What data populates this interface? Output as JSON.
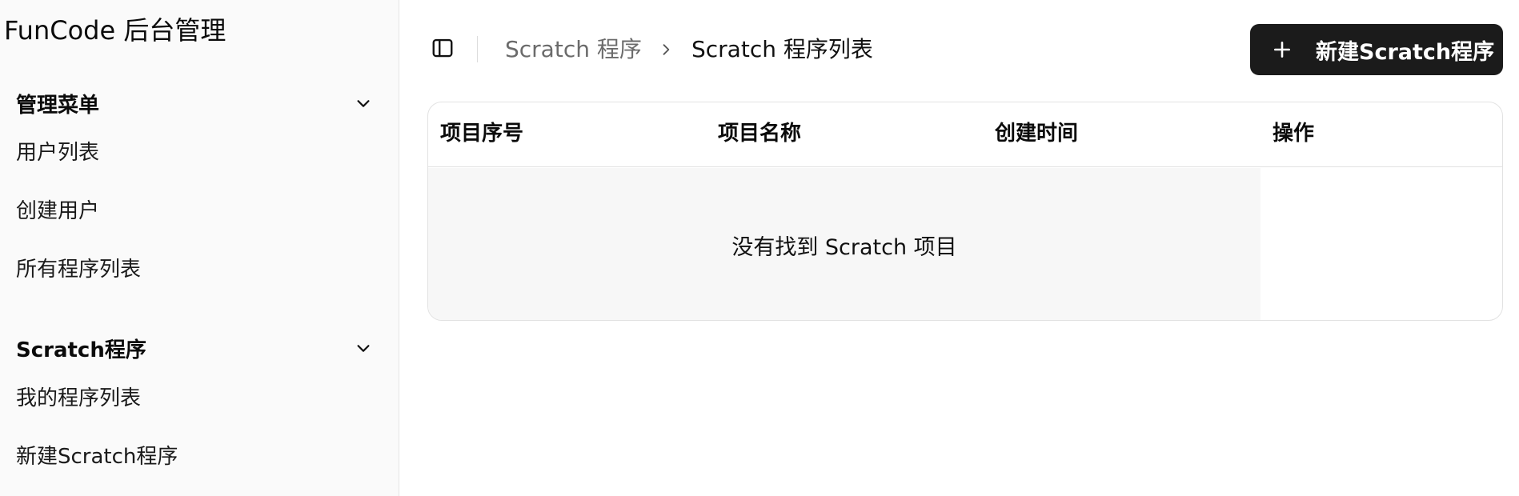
{
  "app": {
    "title": "FunCode 后台管理"
  },
  "sidebar": {
    "groups": [
      {
        "label": "管理菜单",
        "icon": "chevron-down-icon",
        "items": [
          {
            "label": "用户列表"
          },
          {
            "label": "创建用户"
          },
          {
            "label": "所有程序列表"
          }
        ]
      },
      {
        "label": "Scratch程序",
        "icon": "chevron-down-icon",
        "items": [
          {
            "label": "我的程序列表"
          },
          {
            "label": "新建Scratch程序"
          }
        ]
      }
    ]
  },
  "header": {
    "toggle_icon": "sidebar-toggle-icon",
    "breadcrumb": [
      {
        "label": "Scratch 程序"
      },
      {
        "label": "Scratch 程序列表"
      }
    ],
    "separator_icon": "chevron-right-icon",
    "new_button": {
      "label": "新建Scratch程序",
      "icon": "plus-icon"
    }
  },
  "table": {
    "columns": [
      "项目序号",
      "项目名称",
      "创建时间",
      "操作"
    ],
    "rows": [],
    "empty_message": "没有找到 Scratch 项目"
  },
  "colors": {
    "sidebar_bg": "#fafafa",
    "button_bg": "#1b1b1b",
    "empty_row_bg": "#f7f7f7",
    "border": "#e2e2e2",
    "breadcrumb_muted": "#6b6b6b"
  }
}
